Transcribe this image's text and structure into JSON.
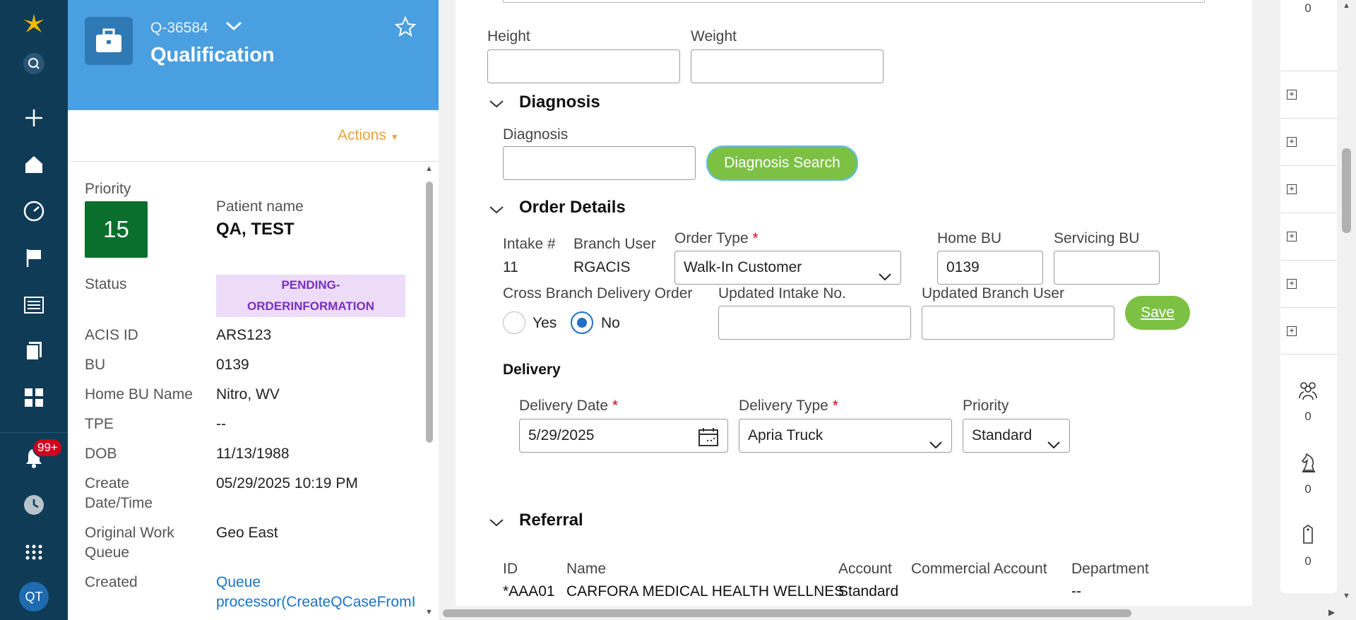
{
  "nav": {
    "notif_count": "99+",
    "avatar": "QT",
    "icons": [
      "logo-icon",
      "search-icon",
      "plus-icon",
      "home-icon",
      "dashboard-icon",
      "flag-icon",
      "news-icon",
      "documents-icon",
      "apps-grid-icon",
      "bell-icon",
      "history-icon",
      "launcher-icon"
    ]
  },
  "case": {
    "id": "Q-36584",
    "title": "Qualification",
    "actions_label": "Actions"
  },
  "summary": {
    "priority_label": "Priority",
    "priority_value": "15",
    "patient_label": "Patient name",
    "patient_value": "QA, TEST",
    "status_label": "Status",
    "status_line1": "PENDING-",
    "status_line2": "ORDERINFORMATION",
    "acis_label": "ACIS ID",
    "acis_value": "ARS123",
    "bu_label": "BU",
    "bu_value": "0139",
    "homebu_label": "Home BU Name",
    "homebu_value": "Nitro, WV",
    "tpe_label": "TPE",
    "tpe_value": "--",
    "dob_label": "DOB",
    "dob_value": "11/13/1988",
    "create_label_1": "Create",
    "create_label_2": "Date/Time",
    "create_value": "05/29/2025 10:19 PM",
    "owq_label_1": "Original Work",
    "owq_label_2": "Queue",
    "owq_value": "Geo East",
    "created_label": "Created",
    "created_value_1": "Queue",
    "created_value_2": "processor(CreateQCaseFromI"
  },
  "form": {
    "height_label": "Height",
    "weight_label": "Weight",
    "height_value": "",
    "weight_value": "",
    "diagnosis_section": "Diagnosis",
    "diagnosis_label": "Diagnosis",
    "diagnosis_value": "",
    "diagnosis_search_btn": "Diagnosis Search",
    "order_section": "Order Details",
    "intake_label": "Intake #",
    "intake_value": "11",
    "branch_user_label": "Branch User",
    "branch_user_value": "RGACIS",
    "order_type_label": "Order Type",
    "order_type_value": "Walk-In Customer",
    "home_bu_label": "Home BU",
    "home_bu_value": "0139",
    "servicing_bu_label": "Servicing BU",
    "servicing_bu_value": "",
    "cross_branch_label": "Cross Branch Delivery Order",
    "yes_label": "Yes",
    "no_label": "No",
    "updated_intake_label": "Updated Intake No.",
    "updated_branch_label": "Updated Branch User",
    "save_btn": "Save",
    "delivery_section": "Delivery",
    "delivery_date_label": "Delivery Date",
    "delivery_date_value": "5/29/2025",
    "delivery_type_label": "Delivery Type",
    "delivery_type_value": "Apria Truck",
    "priority_label": "Priority",
    "priority_value": "Standard",
    "referral_section": "Referral",
    "referral_headers": [
      "ID",
      "Name",
      "Account",
      "Commercial Account",
      "Department"
    ],
    "referral_row": [
      "*AAA01",
      "CARFORA MEDICAL HEALTH WELLNES",
      "Standard",
      "",
      "--"
    ]
  },
  "rail": {
    "top_count": "0",
    "counts": [
      "0",
      "0",
      "0"
    ],
    "icons": [
      "plus-box-icon",
      "people-icon",
      "chess-knight-icon",
      "tag-icon"
    ]
  },
  "colors": {
    "nav_bg": "#0f3b57",
    "header_bg": "#4a9fe0",
    "accent_green": "#7cc144",
    "priority_green": "#0a6e2d",
    "actions_orange": "#e8a33c",
    "status_purple": "#7a2fc2"
  }
}
